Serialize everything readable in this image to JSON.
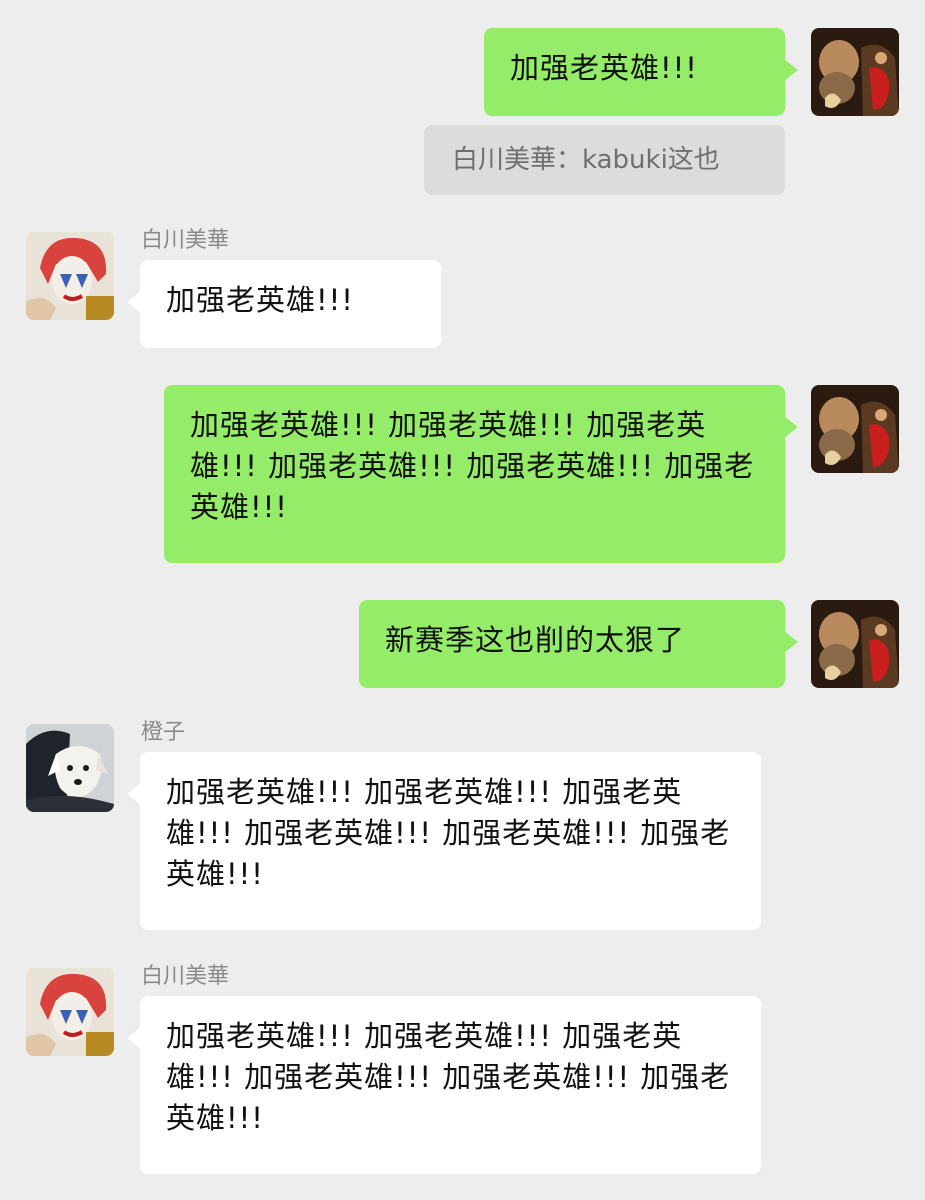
{
  "chat": {
    "messages": [
      {
        "sender": "me",
        "text": "加强老英雄!!!"
      },
      {
        "type": "system",
        "text": "白川美華：kabuki这也"
      },
      {
        "sender": "白川美華",
        "text": "加强老英雄!!!"
      },
      {
        "sender": "me",
        "text": "加强老英雄!!! 加强老英雄!!! 加强老英雄!!! 加强老英雄!!! 加强老英雄!!! 加强老英雄!!!"
      },
      {
        "sender": "me",
        "text": "新赛季这也削的太狠了"
      },
      {
        "sender": "橙子",
        "text": "加强老英雄!!! 加强老英雄!!! 加强老英雄!!! 加强老英雄!!! 加强老英雄!!! 加强老英雄!!!"
      },
      {
        "sender": "白川美華",
        "text": "加强老英雄!!! 加强老英雄!!! 加强老英雄!!! 加强老英雄!!! 加强老英雄!!! 加强老英雄!!!"
      }
    ]
  },
  "colors": {
    "background": "#ededed",
    "outgoing_bubble": "#95ec69",
    "incoming_bubble": "#ffffff",
    "system_notice": "#dcdcdc",
    "sender_name": "#8a8a8a"
  },
  "icons": {
    "me_avatar": "painting-portrait-avatar",
    "shirakawa_avatar": "red-haired-clown-makeup-avatar",
    "chengzi_avatar": "white-puppy-avatar"
  }
}
